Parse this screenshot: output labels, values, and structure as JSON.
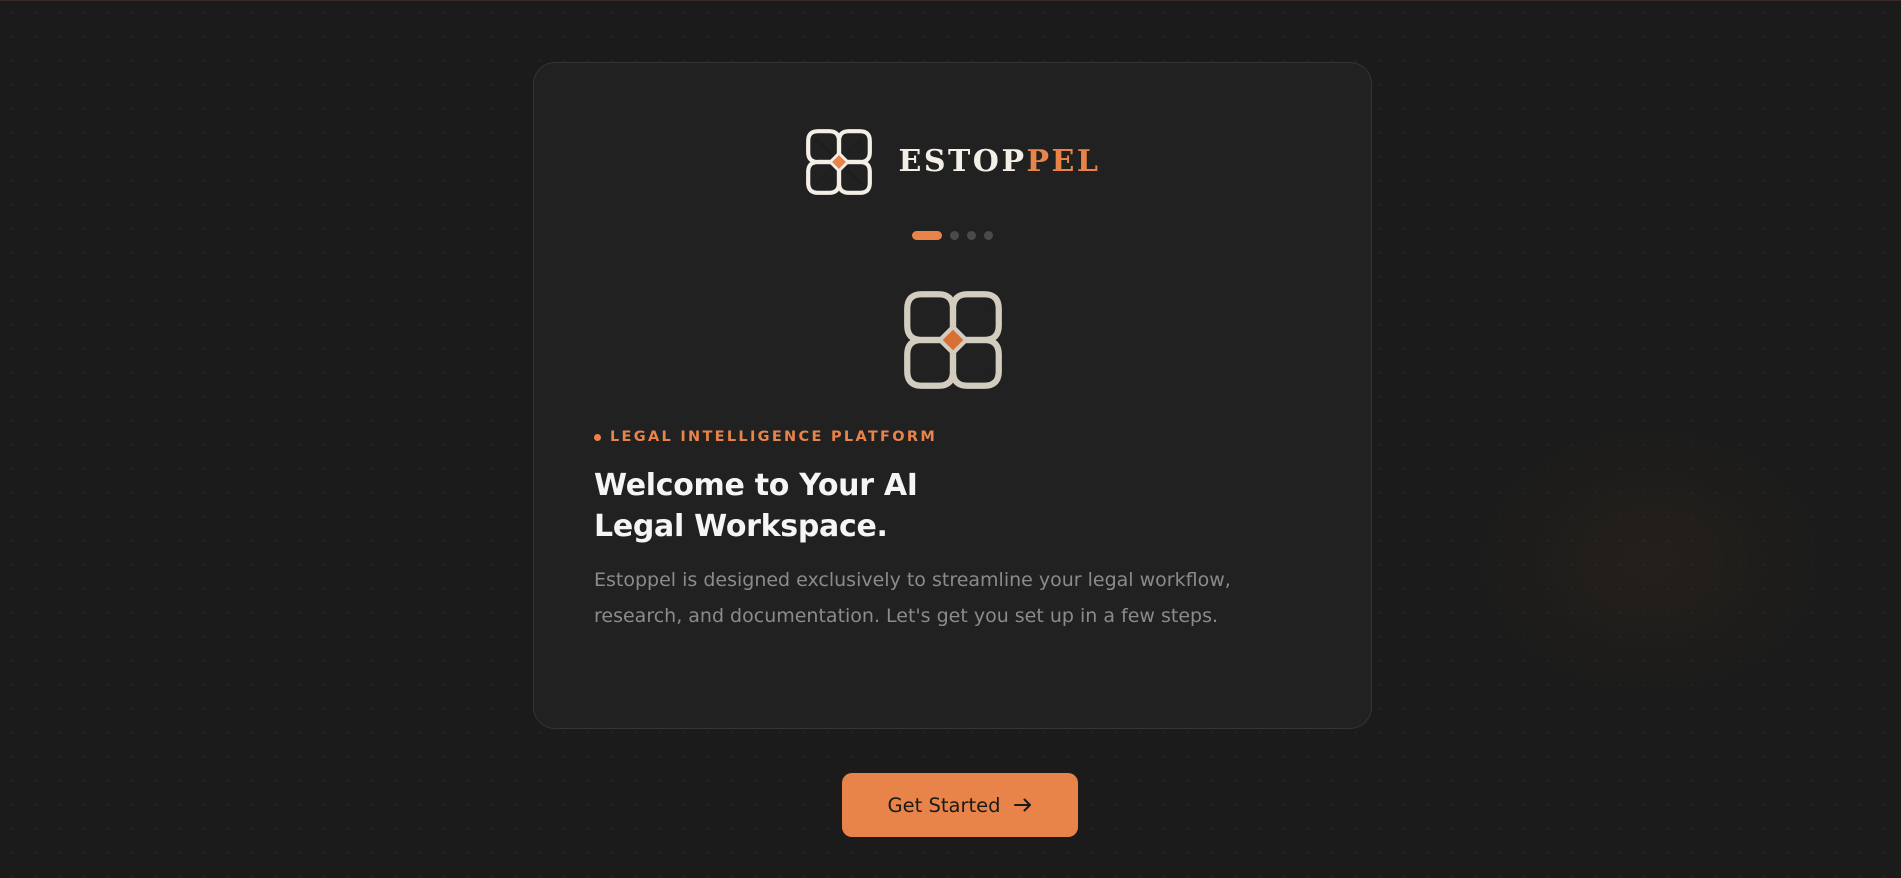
{
  "brand": {
    "name_part1": "ESTOP",
    "name_part2": "PEL",
    "logo_icon": "estoppel-knot-logo-icon"
  },
  "onboarding": {
    "total_steps": 4,
    "current_step": 1,
    "eyebrow": "LEGAL INTELLIGENCE PLATFORM",
    "headline_line1": "Welcome to Your AI",
    "headline_line2": "Legal Workspace.",
    "description_line1": "Estoppel is designed exclusively to streamline your legal workflow,",
    "description_line2": "research, and documentation. Let's get you set up in a few steps."
  },
  "cta": {
    "label": "Get Started",
    "icon": "arrow-right-icon"
  },
  "colors": {
    "accent": "#e8844a",
    "background": "#1b1b1b",
    "card": "#212121",
    "logo_cream": "#f4efe6",
    "hero_logo_beige": "#d3cdbf"
  }
}
